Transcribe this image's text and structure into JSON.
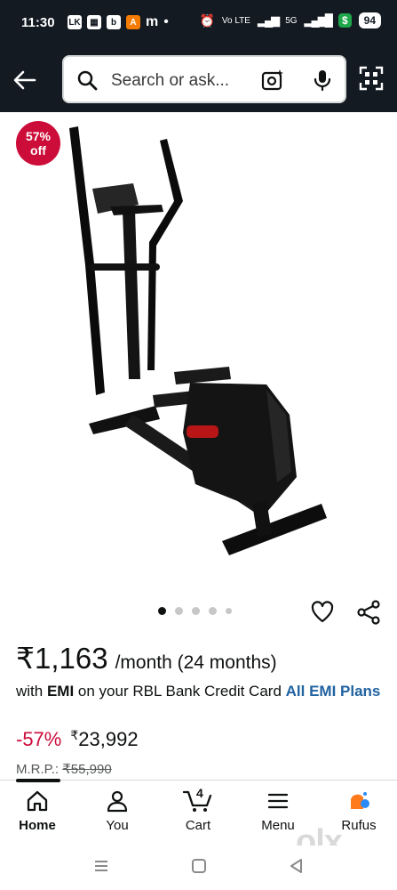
{
  "status_bar": {
    "time": "11:30",
    "notification_icons": [
      "LK",
      "▦",
      "b",
      "A",
      "m"
    ],
    "network": "Vo LTE",
    "signal": "5G",
    "battery": "94"
  },
  "search": {
    "placeholder": "Search or ask..."
  },
  "product": {
    "discount_badge": {
      "pct": "57%",
      "off": "off"
    },
    "image_count": 5,
    "active_image": 1,
    "price_monthly": "₹1,163",
    "price_period": "/month (24 months)",
    "emi_prefix": "with ",
    "emi_bold": "EMI",
    "emi_mid": " on your RBL Bank Credit Card ",
    "emi_link": "All EMI Plans",
    "discount_pct": "-57%",
    "currency": "₹",
    "deal_price": "23,992",
    "mrp_label": "M.R.P.: ",
    "mrp_value": "₹55,990"
  },
  "bottom_nav": {
    "items": [
      {
        "label": "Home",
        "icon": "home-icon",
        "active": true
      },
      {
        "label": "You",
        "icon": "person-icon",
        "active": false
      },
      {
        "label": "Cart",
        "icon": "cart-icon",
        "active": false,
        "count": "4"
      },
      {
        "label": "Menu",
        "icon": "menu-icon",
        "active": false
      },
      {
        "label": "Rufus",
        "icon": "rufus-icon",
        "active": false
      }
    ]
  },
  "watermark": {
    "text": "olx"
  },
  "colors": {
    "header_bg": "#131a22",
    "deal_red": "#cc0c39",
    "link_blue": "#2162a1"
  }
}
